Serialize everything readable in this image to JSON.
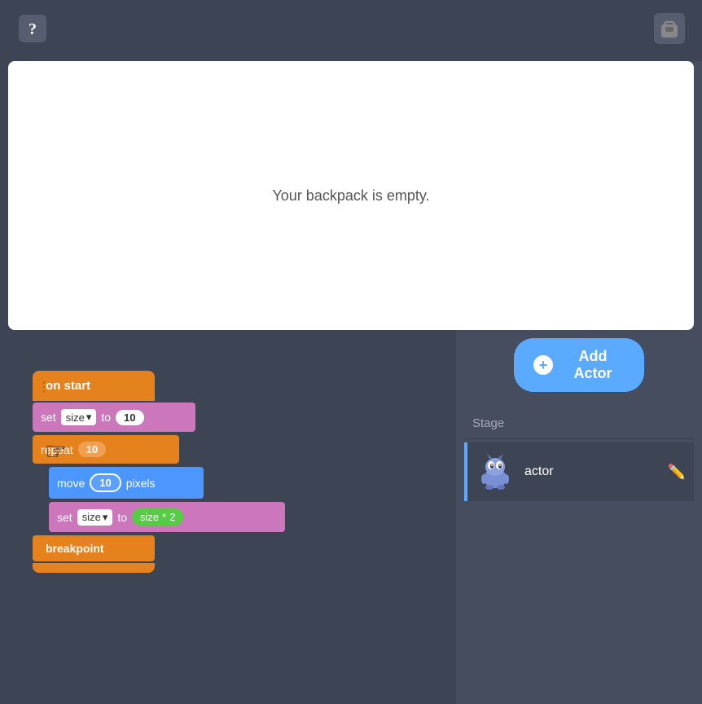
{
  "topbar": {
    "help_label": "?",
    "backpack_label": "🎒"
  },
  "backpack": {
    "empty_text": "Your backpack is empty."
  },
  "blocks": {
    "on_start": "on start",
    "set_label": "set",
    "size_dropdown": "size",
    "to_label": "to",
    "value_10": "10",
    "repeat_label": "repeat",
    "repeat_val": "10",
    "move_label": "move",
    "move_val": "10",
    "pixels_label": "pixels",
    "set_label2": "set",
    "size_dropdown2": "size",
    "to_label2": "to",
    "size_green": "size",
    "multiply": "*",
    "val_2": "2",
    "breakpoint": "breakpoint"
  },
  "right_panel": {
    "add_actor_label": "Add Actor",
    "add_plus": "+",
    "stage_label": "Stage",
    "actor_name": "actor",
    "edit_icon": "✏️"
  }
}
